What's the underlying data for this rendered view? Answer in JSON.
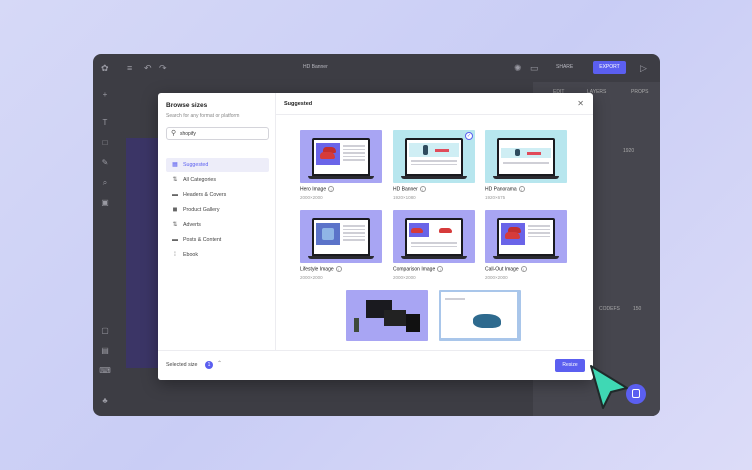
{
  "app": {
    "document_title": "HD Banner",
    "share_label": "SHARE",
    "export_label": "EXPORT",
    "right_tabs": [
      "EDIT",
      "LAYERS",
      "PROPS"
    ],
    "right_texts": [
      "1920",
      "CODEFS",
      "150"
    ]
  },
  "modal": {
    "title": "Browse sizes",
    "subtitle": "Search for any format or platform",
    "search": {
      "value": "shopify",
      "placeholder": "Search"
    },
    "categories": [
      {
        "label": "Suggested",
        "icon": "grid-icon",
        "active": true
      },
      {
        "label": "All Categories",
        "icon": "sort-icon"
      },
      {
        "label": "Headers & Covers",
        "icon": "header-icon"
      },
      {
        "label": "Product Gallery",
        "icon": "bag-icon"
      },
      {
        "label": "Adverts",
        "icon": "sort-icon"
      },
      {
        "label": "Posts & Content",
        "icon": "posts-icon"
      },
      {
        "label": "Ebook",
        "icon": "ebook-icon"
      }
    ],
    "section_title": "Suggested",
    "cards": [
      {
        "name": "Hero Image",
        "size": "2000×2000"
      },
      {
        "name": "HD Banner",
        "size": "1920×1080",
        "selected": true
      },
      {
        "name": "HD Panorama",
        "size": "1920×675"
      },
      {
        "name": "Lifestyle Image",
        "size": "2000×2000"
      },
      {
        "name": "Comparison Image",
        "size": "2000×2000"
      },
      {
        "name": "Call-Out Image",
        "size": "2000×2000"
      }
    ],
    "footer": {
      "selected_label": "Selected size",
      "selected_count": "1",
      "resize_label": "Resize"
    }
  },
  "colors": {
    "accent": "#5b5ff0",
    "thumb_purple": "#a8a5f3",
    "thumb_teal": "#b7e6ee"
  }
}
